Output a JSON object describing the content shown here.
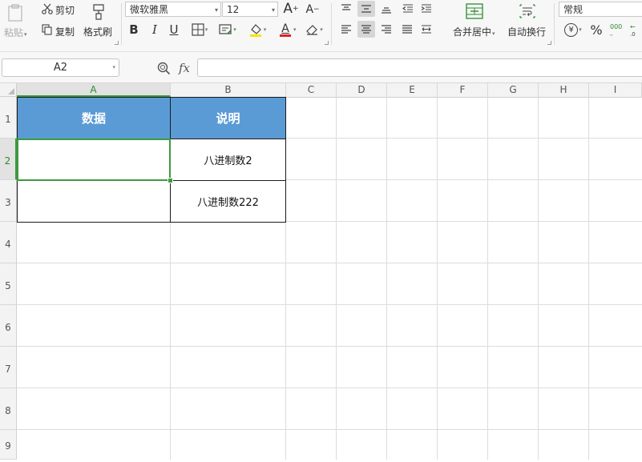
{
  "ribbon": {
    "clipboard": {
      "paste": "粘贴",
      "cut": "剪切",
      "copy": "复制",
      "format_painter": "格式刷"
    },
    "font": {
      "name": "微软雅黑",
      "size": "12"
    },
    "align": {
      "merge_center": "合并居中",
      "wrap_text": "自动换行"
    },
    "number": {
      "format": "常规",
      "currency_symbol": "¥",
      "percent_symbol": "%"
    },
    "glyphs": {
      "bold": "B",
      "italic": "I",
      "underline": "U",
      "font_color": "A",
      "grow": "A",
      "shrink": "A"
    }
  },
  "formula_bar": {
    "name_box": "A2",
    "fx": "fx"
  },
  "columns": [
    "A",
    "B",
    "C",
    "D",
    "E",
    "F",
    "G",
    "H",
    "I"
  ],
  "rows": [
    "1",
    "2",
    "3",
    "4",
    "5",
    "6",
    "7",
    "8",
    "9"
  ],
  "selected": {
    "column": "A",
    "row": "2"
  },
  "cells": {
    "A1": "数据",
    "B1": "说明",
    "A2": "",
    "B2": "八进制数2",
    "A3": "",
    "B3": "八进制数222"
  },
  "colors": {
    "header_fill": "#5b9bd5",
    "selection": "#3d9a3d",
    "font_color_bar": "#e02020",
    "highlight_bar": "#ffe000"
  }
}
